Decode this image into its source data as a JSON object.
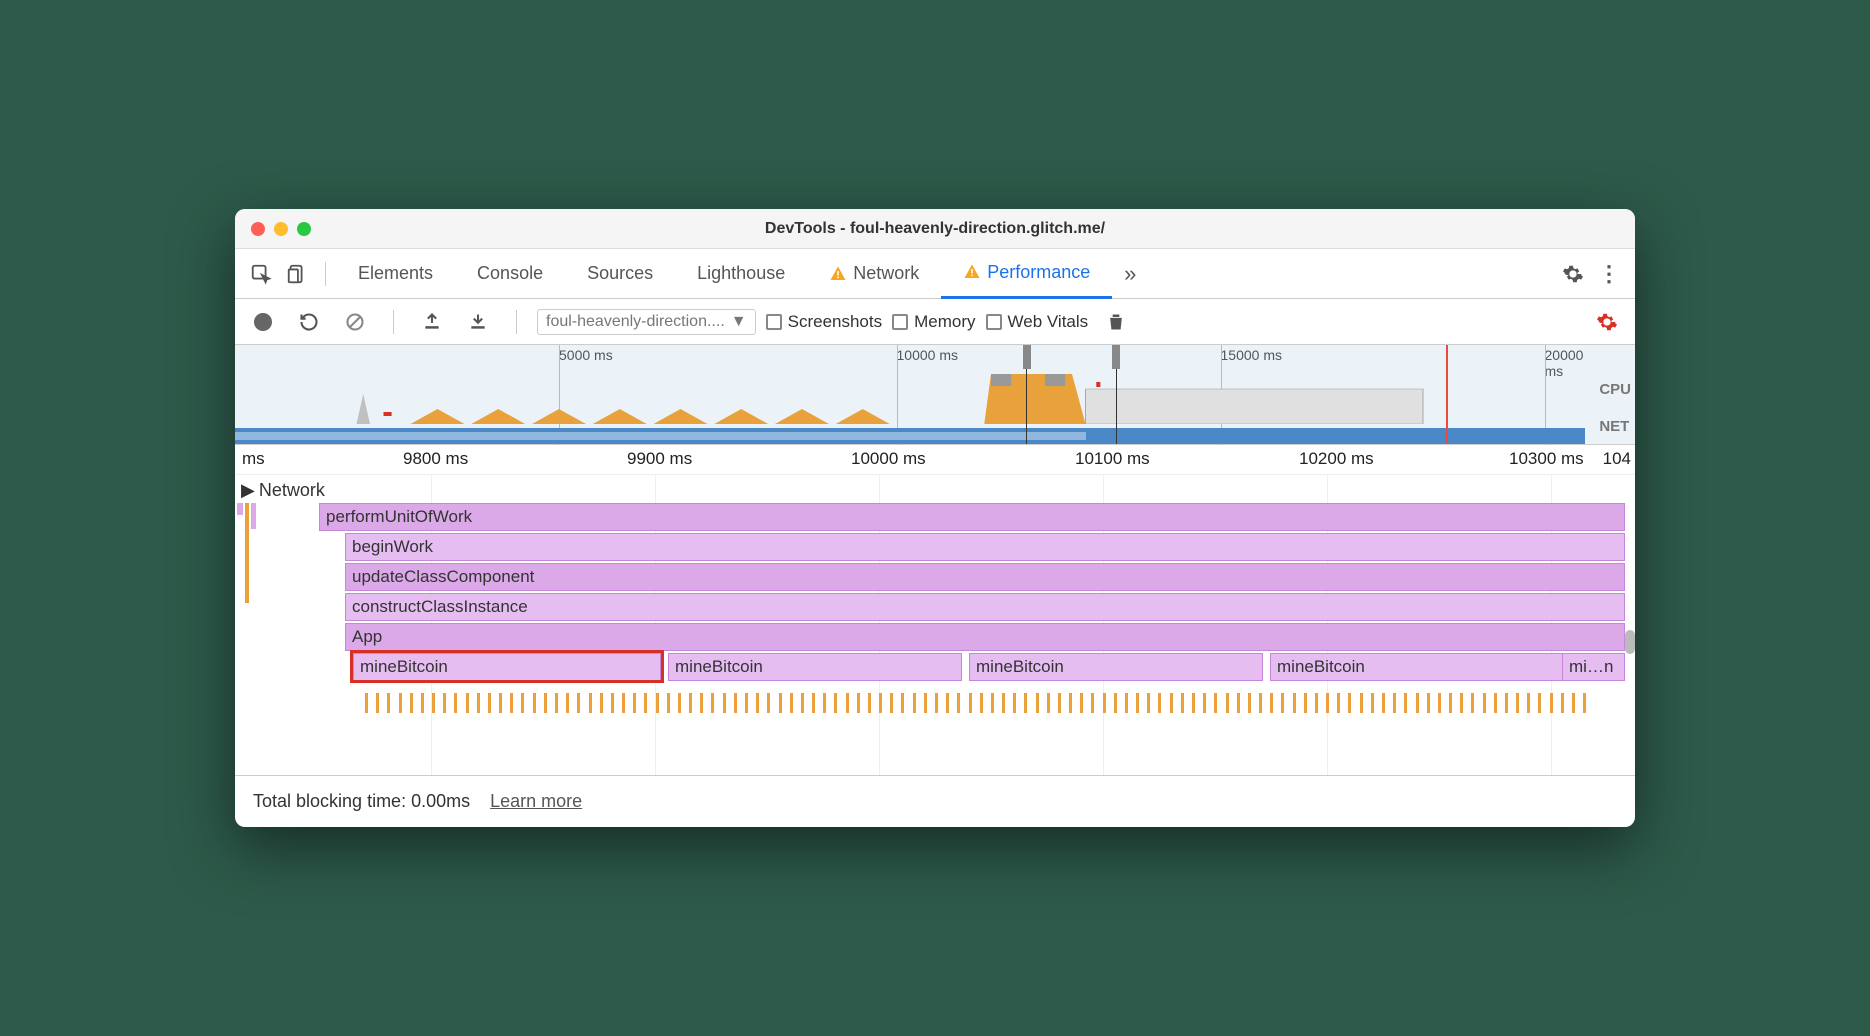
{
  "window": {
    "title": "DevTools - foul-heavenly-direction.glitch.me/"
  },
  "tabs": {
    "elements": "Elements",
    "console": "Console",
    "sources": "Sources",
    "lighthouse": "Lighthouse",
    "network": "Network",
    "performance": "Performance"
  },
  "toolbar": {
    "profile_select": "foul-heavenly-direction....",
    "screenshots": "Screenshots",
    "memory": "Memory",
    "web_vitals": "Web Vitals"
  },
  "overview": {
    "ticks": [
      "5000 ms",
      "10000 ms",
      "15000 ms",
      "20000 ms"
    ],
    "row_labels": {
      "cpu": "CPU",
      "net": "NET"
    }
  },
  "timeline": {
    "ticks": [
      "ms",
      "9800 ms",
      "9900 ms",
      "10000 ms",
      "10100 ms",
      "10200 ms",
      "10300 ms",
      "104"
    ]
  },
  "flame": {
    "network_label": "Network",
    "rows": {
      "performUnitOfWork": "performUnitOfWork",
      "beginWork": "beginWork",
      "updateClassComponent": "updateClassComponent",
      "constructClassInstance": "constructClassInstance",
      "app": "App",
      "mineBitcoin1": "mineBitcoin",
      "mineBitcoin2": "mineBitcoin",
      "mineBitcoin3": "mineBitcoin",
      "mineBitcoin4": "mineBitcoin",
      "mineBitcoin5": "mi…n"
    }
  },
  "footer": {
    "tbt_label": "Total blocking time: 0.00ms",
    "learn_more": "Learn more"
  }
}
